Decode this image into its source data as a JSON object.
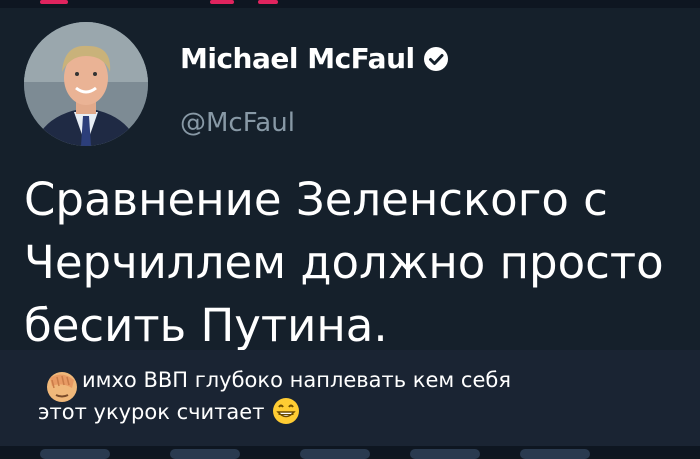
{
  "tweet": {
    "display_name": "Michael McFaul",
    "handle": "@McFaul",
    "text": "Сравнение Зеленского с Черчиллем должно просто бесить Путина.",
    "verified_icon": "verified-badge-icon",
    "avatar_icon": "profile-photo"
  },
  "comment": {
    "text_line1": "имхо ВВП глубоко наплевать кем себя",
    "text_line2": "этот укурок считает",
    "leading_emoji": "facepalm-emoji-icon",
    "trailing_emoji": "grinning-emoji-icon"
  },
  "colors": {
    "background": "#15202b",
    "name": "#ffffff",
    "handle": "#8899a6",
    "comment_bg": "#1a2433"
  }
}
